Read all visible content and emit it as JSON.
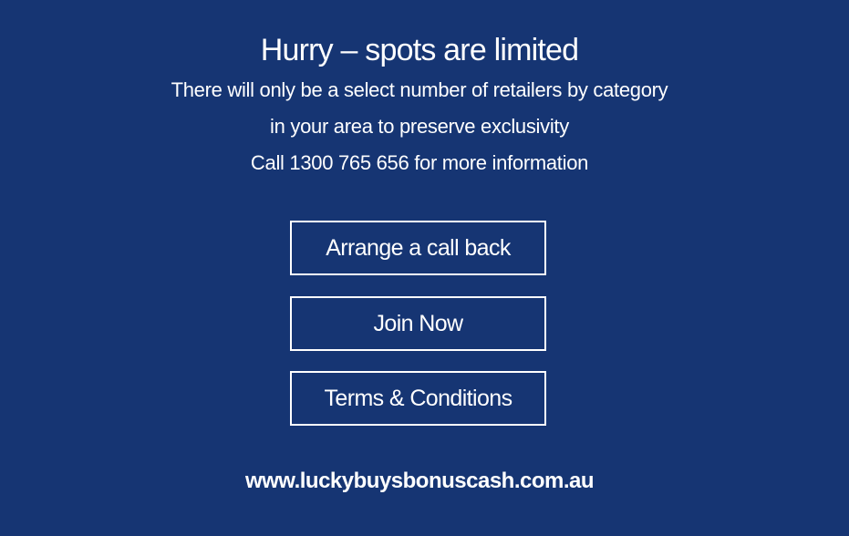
{
  "colors": {
    "background": "#163573",
    "text": "#ffffff",
    "button_border": "#ffffff"
  },
  "headline": "Hurry – spots are limited",
  "body_lines": [
    "There will only be a select number of retailers by category",
    "in your area to preserve exclusivity",
    "Call 1300 765 656 for more information"
  ],
  "buttons": {
    "callback_label": "Arrange a call back",
    "join_label": "Join Now",
    "terms_label": "Terms & Conditions"
  },
  "footer": {
    "website": "www.luckybuysbonuscash.com.au"
  }
}
